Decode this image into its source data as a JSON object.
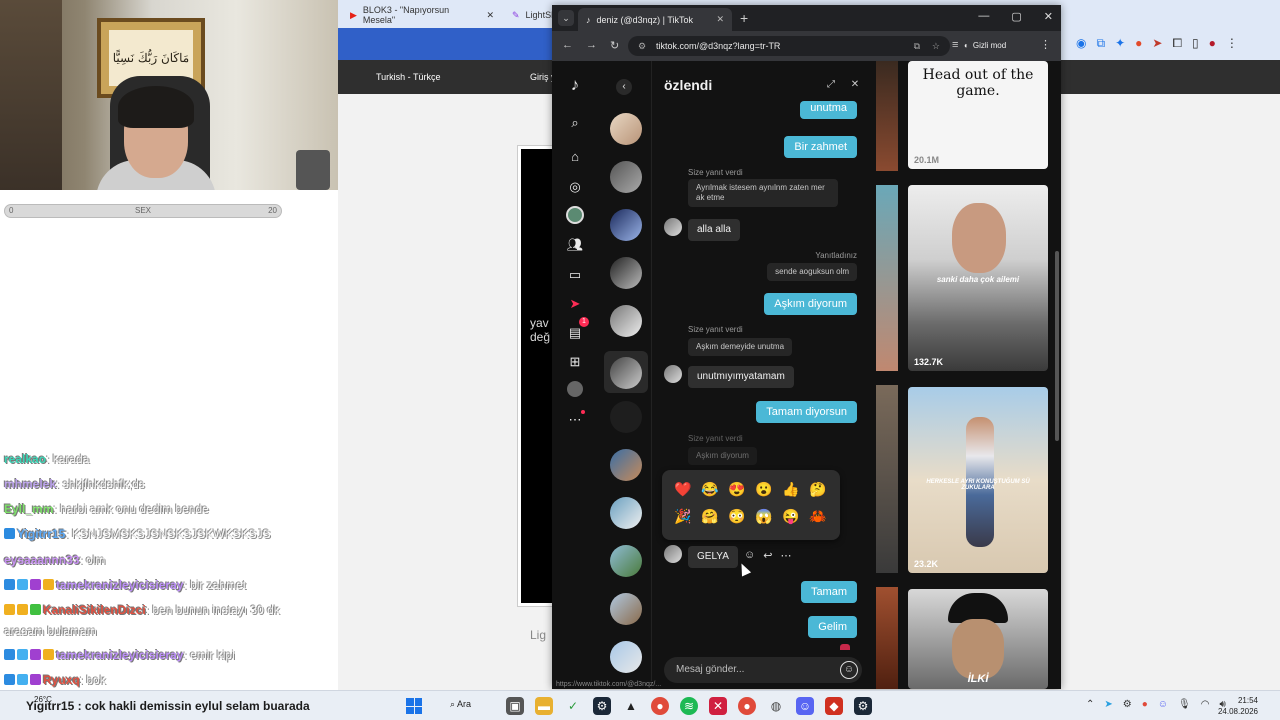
{
  "bg_browser": {
    "tabs": [
      "BLOK3 - \"Napıyorsun Mesela\"",
      "LightSh"
    ],
    "lang_label": "Turkish - Türkçe",
    "login_label": "Giriş y",
    "page_text": "yav\ndeğ",
    "bottom_text": "Lig"
  },
  "webcam": {
    "frame_text": "مَاكَانَ رَبُّكَ نَسِيًّا"
  },
  "progress": {
    "label": "SEX",
    "min": "0",
    "max": "20",
    "value": 0
  },
  "chat": [
    {
      "user": "realkao",
      "msg": ": karada",
      "color": "#39d3b4",
      "badges": []
    },
    {
      "user": "mhmelek",
      "msg": ": shkjfhkdshfk;ds",
      "color": "#b9a0e8",
      "badges": []
    },
    {
      "user": "Eyll_mm",
      "msg": ": harbi amk onu dedim bende",
      "color": "#7ee06a",
      "badges": []
    },
    {
      "user": "Yigitrr15",
      "msg": ": KSNJSMSKSJSNSKSJSKWKSKSJS",
      "color": "#5ba8f5",
      "badges": [
        "#2c8be0"
      ]
    },
    {
      "user": "eysaaannn33",
      "msg": ": olm",
      "color": "#c690f0",
      "badges": []
    },
    {
      "user": "tamekranizleyicisieray",
      "msg": ": bir zahmet",
      "color": "#b98cf5",
      "badges": [
        "#2c8be0",
        "#44b0f0",
        "#a040d0",
        "#f0b020"
      ]
    },
    {
      "user": "KanaliSikilenDizci",
      "msg": ": ben bunun instayı 30 dk",
      "msg2": "arasam bulamam",
      "color": "#e05040",
      "badges": [
        "#f0b020",
        "#f0b020",
        "#40c040"
      ]
    },
    {
      "user": "tamekranizleyicisieray",
      "msg": ": emir kipi",
      "color": "#b98cf5",
      "badges": [
        "#2c8be0",
        "#44b0f0",
        "#a040d0",
        "#f0b020"
      ]
    },
    {
      "user": "Ryuxq",
      "msg": ": bok",
      "color": "#e05040",
      "badges": [
        "#2c8be0",
        "#44b0f0",
        "#a040d0"
      ]
    }
  ],
  "taskbar": {
    "temp": "26°C",
    "caption": "Yigitrr15 : cok hakli demissin eylul selam buarada",
    "search_label": "Ara",
    "time": "21:54",
    "date": "24.08.2026"
  },
  "tiktok": {
    "tab_title": "deniz (@d3nqz) | TikTok",
    "url": "tiktok.com/@d3nqz?lang=tr-TR",
    "incognito_label": "Gizli mod",
    "chat_title": "özlendi",
    "inbox_badge": "1",
    "status_url": "https://www.tiktok.com/@d3nqz/...",
    "messages": {
      "m0": "unutma",
      "m1": "Bir zahmet",
      "reply_label_1": "Size yanıt verdi",
      "quote_1": "Ayrılmak istesem aynılnm zaten mer ak etme",
      "m2": "alla alla",
      "replied_label": "Yanıtladınız",
      "quote_2": "sende aoguksun olm",
      "m3": "Aşkım diyorum",
      "reply_label_2": "Size yanıt verdi",
      "quote_3": "Aşkım demeyide unutma",
      "m4": "unutmıyımyatamam",
      "m5": "Tamam diyorsun",
      "reply_label_3": "Size yanıt verdi",
      "quote_4": "Aşkım diyorum",
      "m6": "GELYA",
      "m7": "Tamam",
      "m8": "Gelim"
    },
    "input_placeholder": "Mesaj gönder...",
    "emojis": [
      "❤️",
      "😂",
      "😍",
      "😮",
      "👍",
      "🤔",
      "🎉",
      "🤗",
      "😳",
      "😱",
      "😜",
      "🦀"
    ],
    "feed": [
      {
        "caption": "Head out of the game.",
        "views": "20.1M"
      },
      {
        "caption": "sanki daha çok ailemi",
        "views": "132.7K"
      },
      {
        "caption": "HERKESLE AYRI KONUŞTUĞUM SÜ ZUKULARA",
        "views": "23.2K"
      },
      {
        "caption": "İLKİ",
        "views": ""
      }
    ]
  }
}
